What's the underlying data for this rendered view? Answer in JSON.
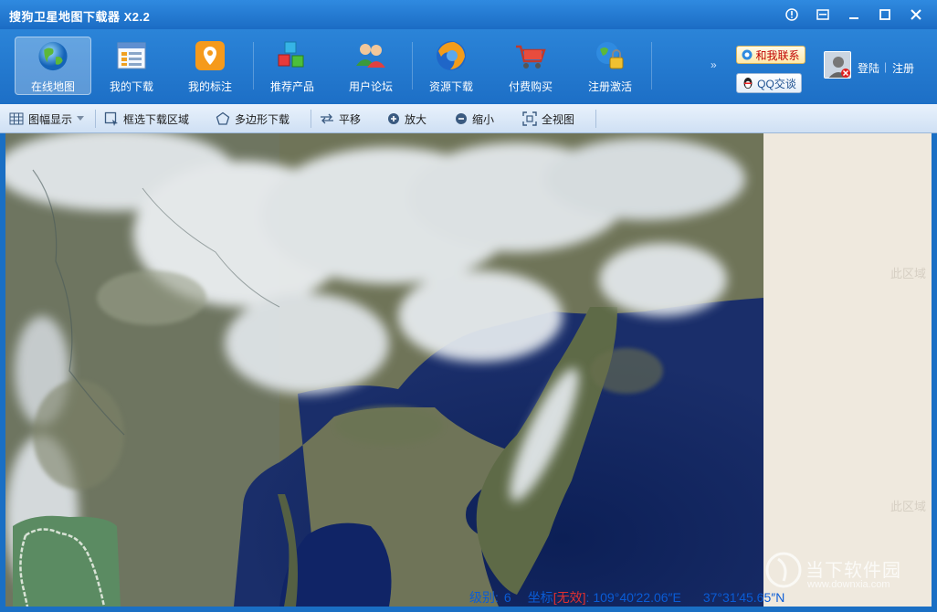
{
  "window": {
    "title": "搜狗卫星地图下载器 X2.2"
  },
  "main_nav": [
    {
      "label": "在线地图",
      "icon": "globe-icon",
      "active": true
    },
    {
      "label": "我的下载",
      "icon": "download-list-icon",
      "active": false
    },
    {
      "label": "我的标注",
      "icon": "map-pin-icon",
      "active": false
    },
    {
      "label": "推荐产品",
      "icon": "cubes-icon",
      "active": false
    },
    {
      "label": "用户论坛",
      "icon": "users-icon",
      "active": false
    },
    {
      "label": "资源下载",
      "icon": "firefox-globe-icon",
      "active": false
    },
    {
      "label": "付费购买",
      "icon": "shopping-cart-icon",
      "active": false
    },
    {
      "label": "注册激活",
      "icon": "lock-globe-icon",
      "active": false
    }
  ],
  "account": {
    "contact_label": "和我联系",
    "qq_label": "QQ交谈",
    "login_label": "登陆",
    "separator": "|",
    "register_label": "注册"
  },
  "map_tools": {
    "frame_display": "图幅显示",
    "box_select": "框选下载区域",
    "polygon": "多边形下载",
    "pan": "平移",
    "zoom_in": "放大",
    "zoom_out": "缩小",
    "full_view": "全视图"
  },
  "map": {
    "outside_label": "此区域"
  },
  "watermark": {
    "text": "当下软件园",
    "url": "www.downxia.com"
  },
  "status": {
    "level_label": "级别:",
    "level_value": "6",
    "coord_label": "坐标",
    "coord_warning": "[无效]",
    "colon": ":",
    "longitude": "109°40′22.06″E",
    "latitude": "37°31′45.65″N"
  },
  "colors": {
    "titlebar": "#2080d8",
    "toolbar": "#1d6fc6",
    "subtoolbar": "#dbe8f7",
    "status_text": "#0a5cd6",
    "status_warning": "#e03030",
    "outside_area": "#efe9de"
  }
}
